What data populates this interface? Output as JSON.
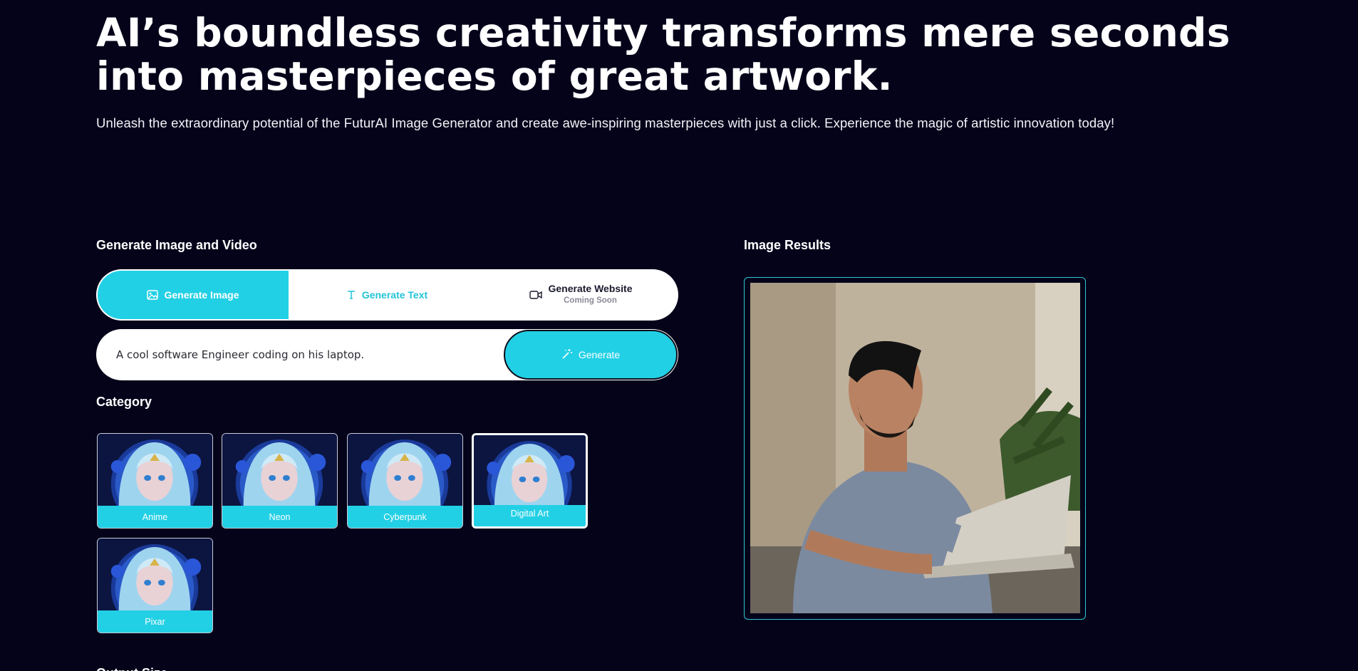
{
  "hero": {
    "title": "AI’s boundless creativity transforms mere seconds into masterpieces of great artwork.",
    "subtitle": "Unleash the extraordinary potential of the FuturAI Image Generator and create awe-inspiring masterpieces with just a click. Experience the magic of artistic innovation today!"
  },
  "generator": {
    "section_title": "Generate Image and Video",
    "tabs": [
      {
        "label": "Generate Image",
        "icon": "image-icon",
        "active": true
      },
      {
        "label": "Generate Text",
        "icon": "text-icon",
        "active": false
      },
      {
        "label": "Generate Website",
        "sublabel": "Coming Soon",
        "icon": "video-icon",
        "active": false
      }
    ],
    "prompt_value": "A cool software Engineer coding on his laptop.",
    "generate_label": "Generate"
  },
  "category": {
    "title": "Category",
    "items": [
      {
        "label": "Anime",
        "selected": false
      },
      {
        "label": "Neon",
        "selected": false
      },
      {
        "label": "Cyberpunk",
        "selected": false
      },
      {
        "label": "Digital Art",
        "selected": true
      },
      {
        "label": "Pixar",
        "selected": false
      }
    ]
  },
  "results": {
    "title": "Image Results"
  },
  "next_section_title": "Output Size",
  "colors": {
    "background": "#05031a",
    "accent": "#22d0e5",
    "white": "#ffffff"
  }
}
